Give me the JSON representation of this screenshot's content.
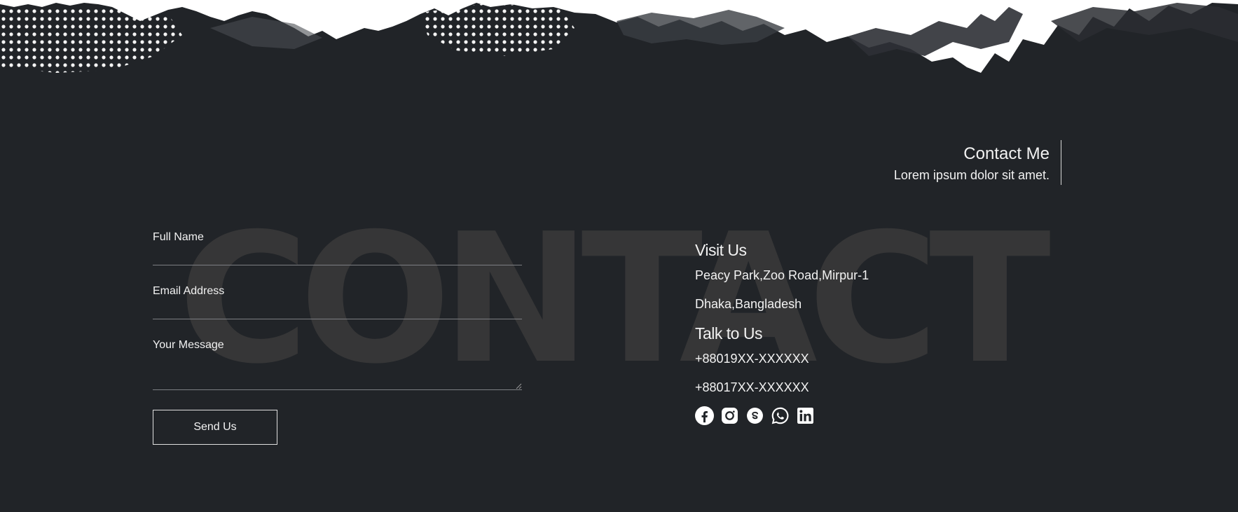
{
  "background_word": "CONTACT",
  "header": {
    "title": "Contact Me",
    "subtitle": "Lorem ipsum dolor sit amet."
  },
  "form": {
    "full_name_label": "Full Name",
    "email_label": "Email Address",
    "message_label": "Your Message",
    "submit_label": "Send Us"
  },
  "info": {
    "visit_title": "Visit Us",
    "address_line1": "Peacy Park,Zoo Road,Mirpur-1",
    "address_line2": "Dhaka,Bangladesh",
    "talk_title": "Talk to Us",
    "phone1": "+88019XX-XXXXXX",
    "phone2": "+88017XX-XXXXXX"
  },
  "socials": [
    "facebook-icon",
    "instagram-icon",
    "skype-icon",
    "whatsapp-icon",
    "linkedin-icon"
  ],
  "colors": {
    "background": "#212428",
    "background_word": "#363637",
    "text": "#f2f2f2",
    "divider": "#7d7f83"
  }
}
